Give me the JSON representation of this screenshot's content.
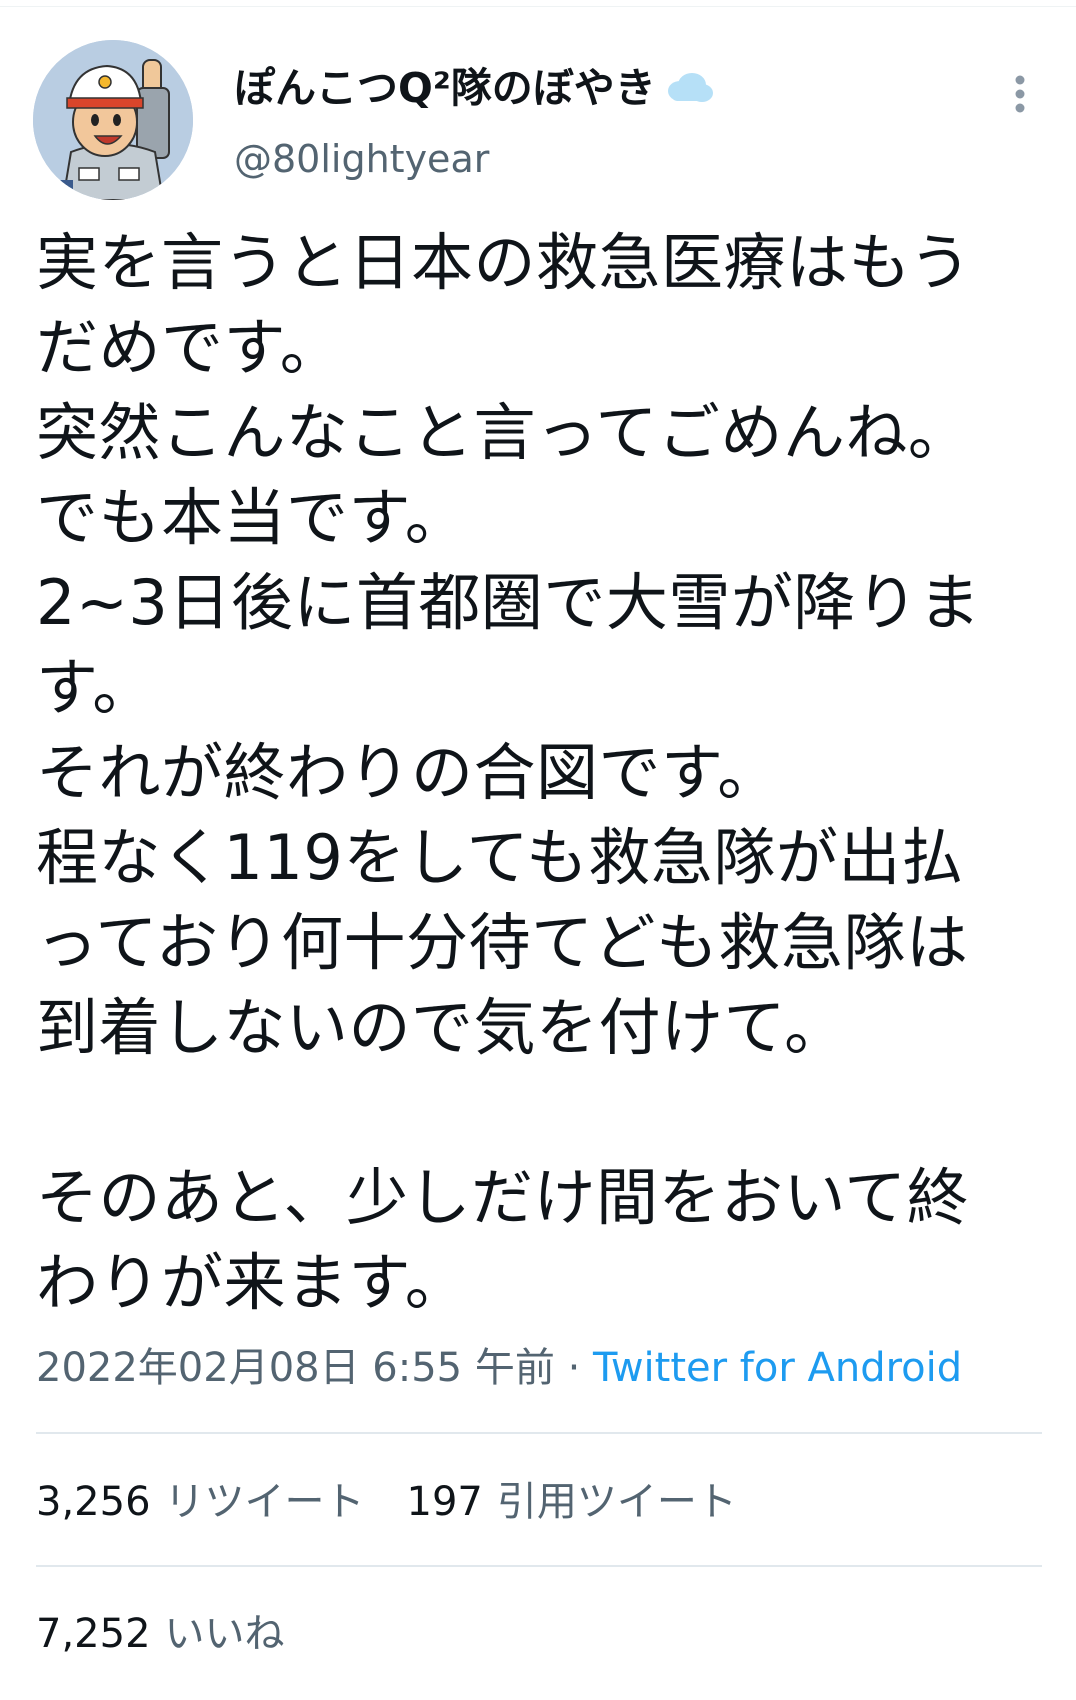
{
  "user": {
    "display_name": "ぽんこつQ²隊のぼやき",
    "handle": "@80lightyear",
    "avatar_icon": "cartoon-avatar-icon",
    "badge_icon": "cloud-icon"
  },
  "tweet": {
    "lines": [
      "実を言うと日本の救急医療はもう",
      "だめです。",
      "突然こんなこと言ってごめんね。",
      "でも本当です。",
      "2~3日後に首都圏で大雪が降りま",
      "す。",
      "それが終わりの合図です。",
      "程なく119をしても救急隊が出払",
      "っており何十分待てども救急隊は",
      "到着しないので気を付けて。",
      "",
      "そのあと、少しだけ間をおいて終",
      "わりが来ます。"
    ]
  },
  "meta": {
    "timestamp": "2022年02月08日 6:55 午前",
    "separator": "·",
    "source": "Twitter for Android"
  },
  "stats": {
    "retweets_count": "3,256",
    "retweets_label": "リツイート",
    "quotes_count": "197",
    "quotes_label": "引用ツイート",
    "likes_count": "7,252",
    "likes_label": "いいね"
  },
  "colors": {
    "text": "#0f1419",
    "secondary": "#536471",
    "link": "#1d9bf0",
    "divider": "#e1e8ed"
  }
}
